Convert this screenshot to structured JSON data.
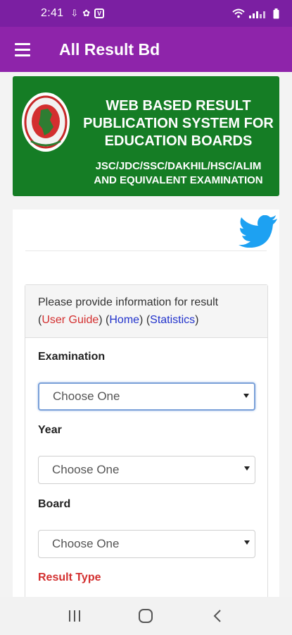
{
  "status_bar": {
    "time": "2:41",
    "battery": "battery-icon",
    "wifi": "wifi-icon"
  },
  "app_bar": {
    "title": "All Result Bd"
  },
  "banner": {
    "title_line1": "WEB BASED RESULT",
    "title_line2": "PUBLICATION SYSTEM FOR",
    "title_line3": "EDUCATION BOARDS",
    "sub_line1": "JSC/JDC/SSC/DAKHIL/HSC/ALIM",
    "sub_line2": "AND EQUIVALENT EXAMINATION",
    "bg_color": "#157d25"
  },
  "form": {
    "intro": "Please provide information for result",
    "paren_open": "(",
    "paren_close": ")",
    "user_guide": "User Guide",
    "home": "Home",
    "statistics": "Statistics",
    "fields": [
      {
        "label": "Examination",
        "value": "Choose One"
      },
      {
        "label": "Year",
        "value": "Choose One"
      },
      {
        "label": "Board",
        "value": "Choose One"
      },
      {
        "label": "Result Type",
        "value": ""
      }
    ]
  },
  "colors": {
    "status_bar": "#7b1fa2",
    "app_bar": "#8e24aa",
    "accent_red": "#d32f2f",
    "link_blue": "#2233cc",
    "twitter": "#1da1f2"
  }
}
